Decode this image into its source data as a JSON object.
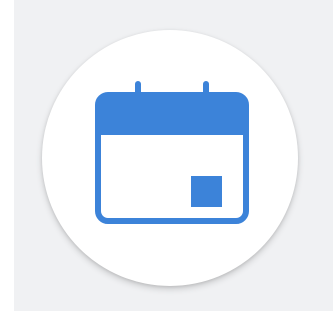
{
  "app_icon": {
    "icon": "calendar-icon",
    "icon_color": "#3c83d9",
    "circle_color": "#ffffff",
    "background_color": "#f0f1f3"
  }
}
